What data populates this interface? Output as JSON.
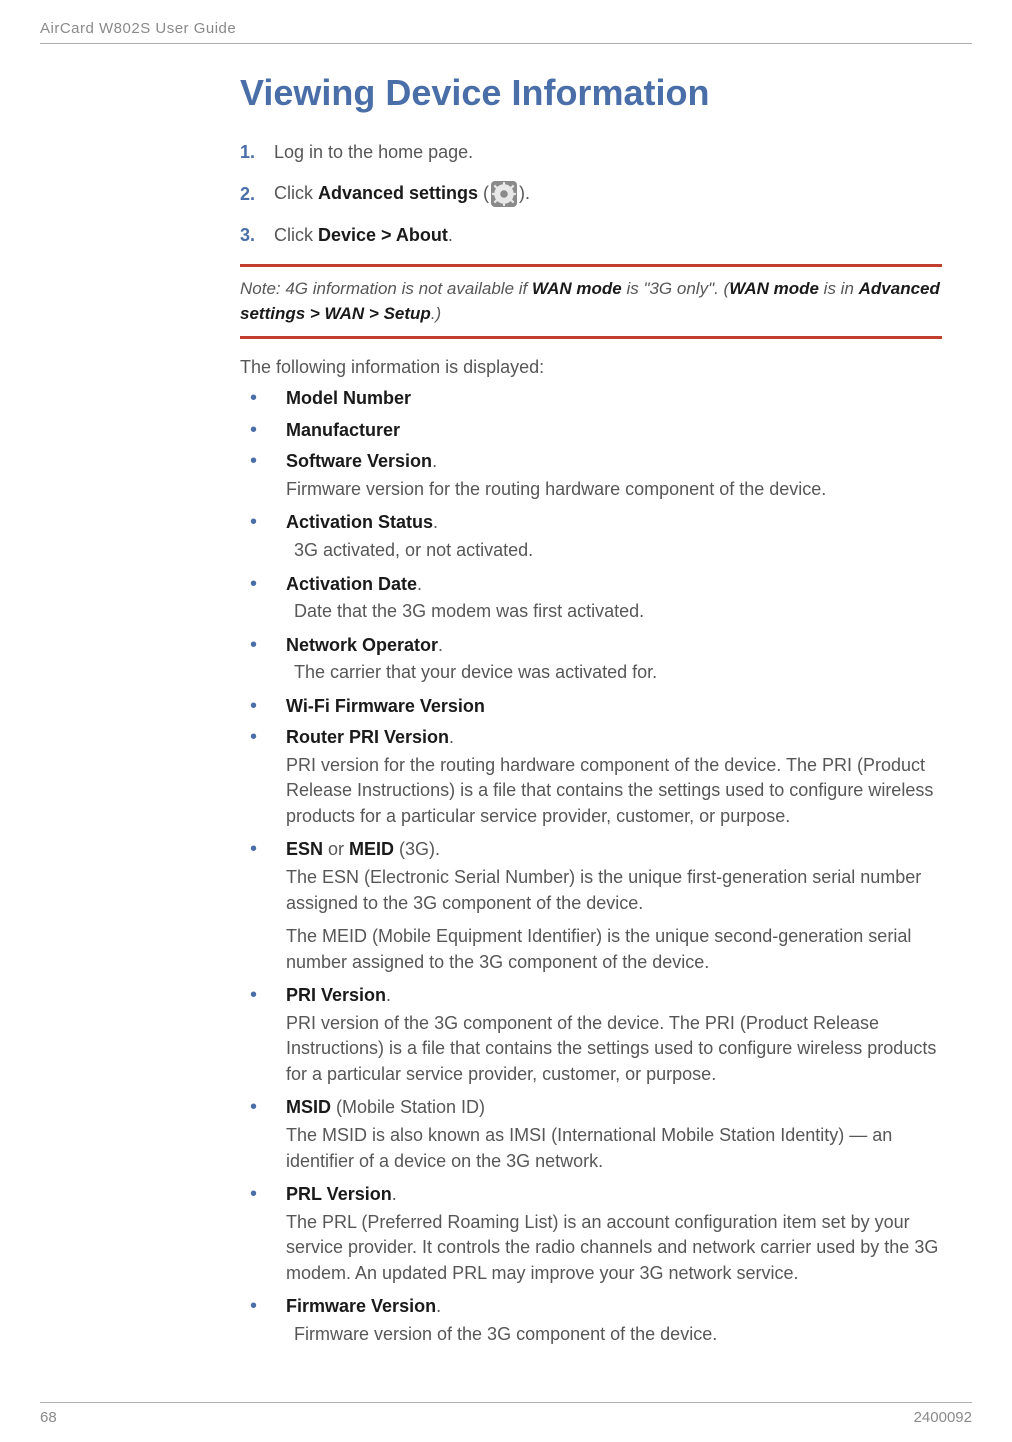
{
  "header": {
    "running": "AirCard W802S User Guide"
  },
  "title": "Viewing Device Information",
  "steps": [
    {
      "num": "1.",
      "pre": "Log in to the home page.",
      "bold": "",
      "post": ""
    },
    {
      "num": "2.",
      "pre": "Click ",
      "bold": "Advanced settings",
      "post": " (",
      "icon": true,
      "tail": ")."
    },
    {
      "num": "3.",
      "pre": "Click ",
      "bold": "Device > About",
      "post": "."
    }
  ],
  "note": {
    "lead": "Note:  4G information is not available if ",
    "b1": "WAN mode",
    "mid": " is \"3G only\". (",
    "b2": "WAN mode",
    "mid2": " is in ",
    "b3": "Advanced settings > WAN > Setup",
    "tail": ".)"
  },
  "intro": "The following information is displayed:",
  "items": [
    {
      "term": "Model Number",
      "suffix": ""
    },
    {
      "term": "Manufacturer",
      "suffix": ""
    },
    {
      "term": "Software Version",
      "suffix": ".",
      "desc": "Firmware version for the routing hardware component of the device."
    },
    {
      "term": "Activation Status",
      "suffix": ".",
      "desc_indent": " 3G activated, or not activated."
    },
    {
      "term": "Activation Date",
      "suffix": ".",
      "desc_indent": " Date that the 3G modem was first activated."
    },
    {
      "term": "Network Operator",
      "suffix": ".",
      "desc_indent": " The carrier that your device was activated for."
    },
    {
      "term": "Wi-Fi Firmware Version",
      "suffix": ""
    },
    {
      "term": "Router PRI Version",
      "suffix": ".",
      "desc": "PRI version for the routing hardware component of the device. The PRI (Product Release Instructions) is a file that contains the settings used to configure wireless products for a particular service provider, customer, or purpose."
    },
    {
      "term": "ESN",
      "mid": " or ",
      "term2": "MEID",
      "suffix": " (3G).",
      "desc": "The ESN (Electronic Serial Number) is the unique first-generation serial number assigned to the 3G component of the device.",
      "desc2": "The MEID (Mobile Equipment Identifier) is the unique second-generation serial number assigned to the 3G component of the device."
    },
    {
      "term": "PRI Version",
      "suffix": ".",
      "desc": "PRI version of the 3G component of the device. The PRI (Product Release Instructions) is a file that contains the settings used to configure wireless products for a particular service provider, customer, or purpose."
    },
    {
      "term": "MSID",
      "suffix": " (Mobile Station ID)",
      "desc": "The MSID is also known as IMSI (International Mobile Station Identity) — an identifier of a device on the 3G network."
    },
    {
      "term": "PRL Version",
      "suffix": ".",
      "desc": "The PRL (Preferred Roaming List) is an account configuration item set by your service provider. It controls the radio channels and network carrier used by the 3G modem. An updated PRL may improve your 3G network service."
    },
    {
      "term": "Firmware Version",
      "suffix": ".",
      "desc_indent": " Firmware version of the 3G component of the device."
    }
  ],
  "footer": {
    "page": "68",
    "doc": "2400092"
  }
}
